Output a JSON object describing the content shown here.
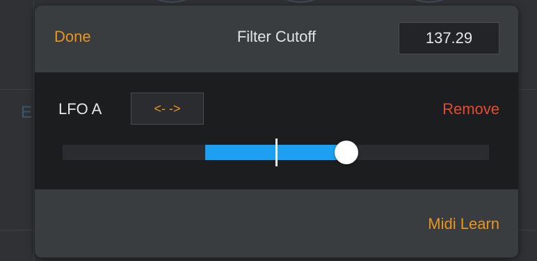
{
  "header": {
    "done_label": "Done",
    "parameter_name": "Filter Cutoff",
    "parameter_value": "137.29"
  },
  "modulation": {
    "source_label": "LFO A",
    "direction_label": "<- ->",
    "remove_label": "Remove",
    "depth": {
      "center": 0.5,
      "fill_start": 0.335,
      "fill_end": 0.665
    }
  },
  "footer": {
    "midi_learn_label": "Midi Learn"
  },
  "background": {
    "partial_letter": "E"
  },
  "colors": {
    "accent": "#e9951f",
    "destructive": "#e24b34",
    "slider_fill": "#1ea0f2",
    "panel": "#3a3d40",
    "section": "#1c1d1f"
  }
}
